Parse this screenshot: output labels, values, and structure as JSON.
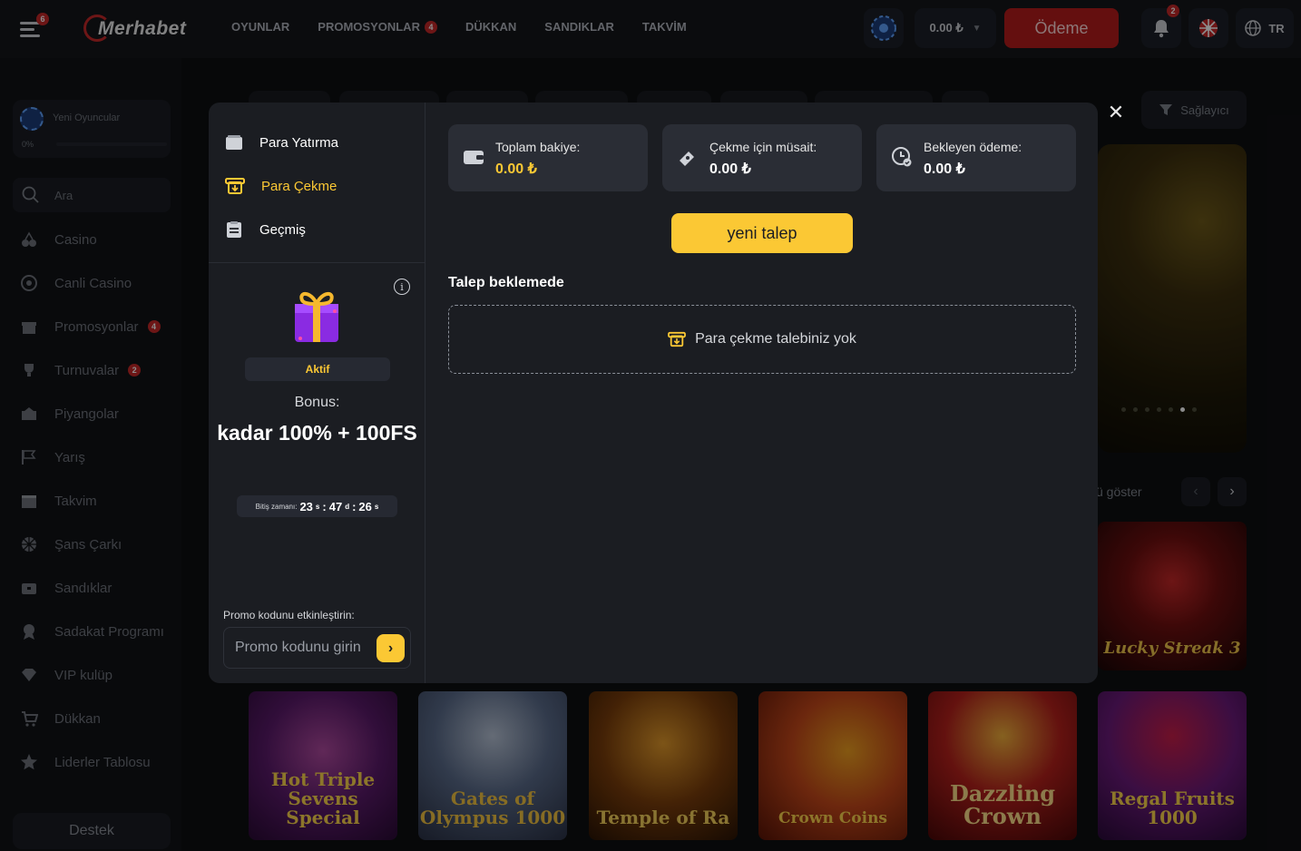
{
  "header": {
    "menu_badge": "6",
    "logo_text": "Merhabet",
    "nav": [
      {
        "label": "OYUNLAR",
        "badge": ""
      },
      {
        "label": "PROMOSYONLAR",
        "badge": "4"
      },
      {
        "label": "DÜKKAN",
        "badge": ""
      },
      {
        "label": "SANDIKLAR",
        "badge": ""
      },
      {
        "label": "TAKVİM",
        "badge": ""
      }
    ],
    "balance": "0.00 ₺",
    "pay_button": "Ödeme",
    "notif_badge": "2",
    "language": "TR"
  },
  "sidebar": {
    "level_label": "Yeni Oyuncular",
    "level_progress_text": "0%",
    "level_progress": 0,
    "search_placeholder": "Ara",
    "items": [
      {
        "label": "Casino",
        "badge": ""
      },
      {
        "label": "Canli Casino",
        "badge": ""
      },
      {
        "label": "Promosyonlar",
        "badge": "4"
      },
      {
        "label": "Turnuvalar",
        "badge": "2"
      },
      {
        "label": "Piyangolar",
        "badge": ""
      },
      {
        "label": "Yarış",
        "badge": ""
      },
      {
        "label": "Takvim",
        "badge": ""
      },
      {
        "label": "Şans Çarkı",
        "badge": ""
      },
      {
        "label": "Sandıklar",
        "badge": ""
      },
      {
        "label": "Sadakat Programı",
        "badge": ""
      },
      {
        "label": "VIP kulüp",
        "badge": ""
      },
      {
        "label": "Dükkan",
        "badge": ""
      },
      {
        "label": "Liderler Tablosu",
        "badge": ""
      }
    ],
    "support": "Destek"
  },
  "background": {
    "provider_filter": "Sağlayıcı",
    "show_all_partial": "ü göster",
    "carousel_active_index": 5,
    "carousel_count": 7,
    "games": [
      {
        "title": "Hot Triple Sevens Special"
      },
      {
        "title": "Gates of Olympus 1000"
      },
      {
        "title": "Temple of Ra"
      },
      {
        "title": "Crown Coins"
      },
      {
        "title": "Dazzling Crown"
      },
      {
        "title": "Regal Fruits 1000"
      },
      {
        "title": "Lucky Streak 3"
      }
    ]
  },
  "modal": {
    "menu": [
      {
        "label": "Para Yatırma",
        "icon": "wallet-icon",
        "active": false
      },
      {
        "label": "Para Çekme",
        "icon": "withdraw-icon",
        "active": true
      },
      {
        "label": "Geçmiş",
        "icon": "history-icon",
        "active": false
      }
    ],
    "bonus": {
      "status": "Aktif",
      "label": "Bonus:",
      "value": "kadar 100% + 100FS",
      "timer_label": "Bitiş zamanı:",
      "hours": "23",
      "hours_unit": "s",
      "minutes": "47",
      "minutes_unit": "d",
      "seconds": "26",
      "seconds_unit": "s"
    },
    "promo": {
      "label": "Promo kodunu etkinleştirin:",
      "placeholder": "Promo kodunu girin"
    },
    "cards": [
      {
        "label": "Toplam bakiye:",
        "value": "0.00 ₺"
      },
      {
        "label": "Çekme için müsait:",
        "value": "0.00 ₺"
      },
      {
        "label": "Bekleyen ödeme:",
        "value": "0.00 ₺"
      }
    ],
    "new_request": "yeni talep",
    "pending_title": "Talep beklemede",
    "empty_text": "Para çekme talebiniz yok"
  },
  "colors": {
    "accent": "#fbc834",
    "brand_red": "#b71c1c",
    "modal_bg": "#1b1d22"
  }
}
